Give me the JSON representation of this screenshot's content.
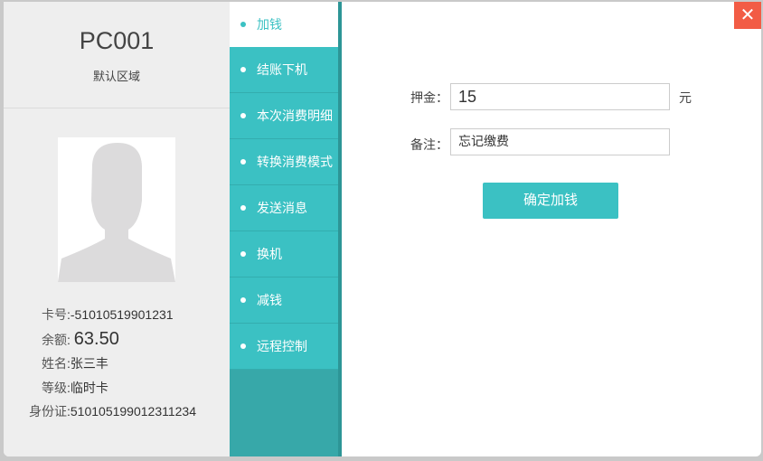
{
  "machine": {
    "name": "PC001",
    "area": "默认区域"
  },
  "user": [
    {
      "label": "卡号",
      "value": "-51010519901231"
    },
    {
      "label": "余额",
      "value": "63.50"
    },
    {
      "label": "姓名",
      "value": "张三丰"
    },
    {
      "label": "等级",
      "value": "临时卡"
    },
    {
      "label": "身份证",
      "value": "510105199012311234"
    }
  ],
  "menu": [
    "加钱",
    "结账下机",
    "本次消费明细",
    "转换消费模式",
    "发送消息",
    "换机",
    "减钱",
    "远程控制"
  ],
  "form": {
    "deposit_label": "押金：",
    "deposit_value": "15",
    "unit": "元",
    "note_label": "备注：",
    "note_value": "忘记缴费",
    "submit": "确定加钱"
  },
  "close": "✕",
  "colors": {
    "accent": "#3bc1c3",
    "close": "#f25c45"
  }
}
